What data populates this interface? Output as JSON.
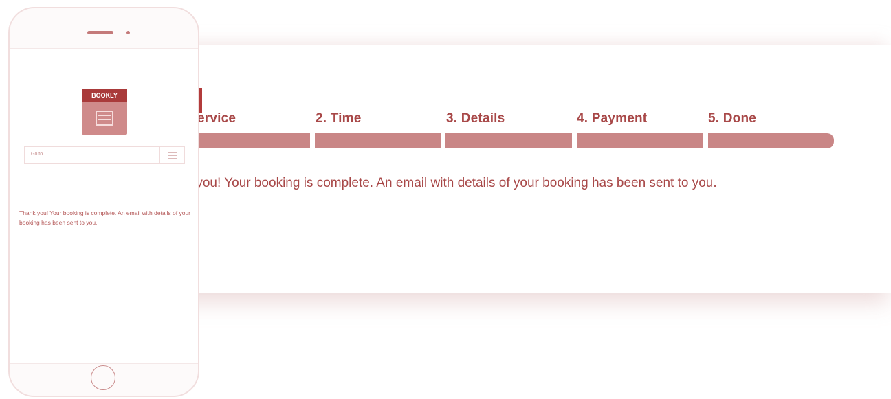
{
  "booking": {
    "steps": [
      {
        "label": "ervice"
      },
      {
        "label": "2. Time"
      },
      {
        "label": "3. Details"
      },
      {
        "label": "4. Payment"
      },
      {
        "label": "5. Done"
      }
    ],
    "message": "nk you! Your booking is complete. An email with details of your booking has been sent to you."
  },
  "phone": {
    "logo_text": "BOOKLY",
    "goto_placeholder": "Go to...",
    "message": "Thank you! Your booking is complete. An email with details of your booking has been sent to you."
  },
  "colors": {
    "accent": "#a84848",
    "bar": "#c98686",
    "logo_dark": "#a93a3a"
  },
  "icons": [
    "menu-icon",
    "calendar-icon",
    "home-button-icon"
  ]
}
